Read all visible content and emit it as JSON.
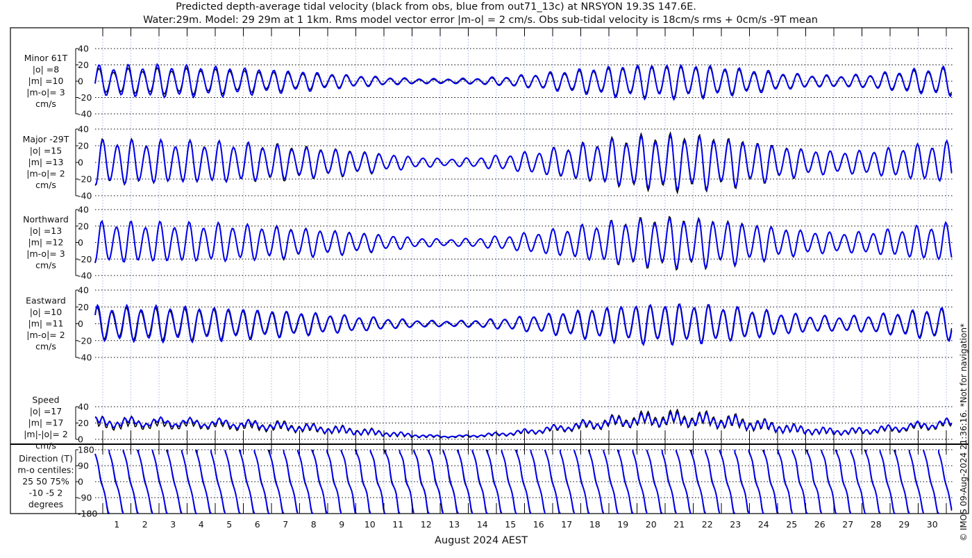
{
  "title": {
    "line1": "Predicted depth-average tidal velocity (black from obs, blue from out71_13c) at NRSYON 19.3S 147.6E.",
    "line2": "Water:29m. Model: 29 29m at 1 1km. Rms model vector error |m-o| = 2 cm/s. Obs sub-tidal velocity is 18cm/s rms + 0cm/s -9T mean"
  },
  "side_note": "© IMOS 09-Aug-2024 21:36:16. *Not for navigation*",
  "colors": {
    "obs": "#000000",
    "model": "#0000ee",
    "grid": "#a8b8e8"
  },
  "chart_data": {
    "type": "line",
    "xlabel": "August 2024 AEST",
    "x_tick_labels": [
      "1",
      "2",
      "3",
      "4",
      "5",
      "6",
      "7",
      "8",
      "9",
      "10",
      "11",
      "12",
      "13",
      "14",
      "15",
      "16",
      "17",
      "18",
      "19",
      "20",
      "21",
      "22",
      "23",
      "24",
      "25",
      "26",
      "27",
      "28",
      "29",
      "30"
    ],
    "x_range": [
      "2024-07-31 18:00",
      "2024-08-31 05:00"
    ],
    "grid": true,
    "amplitude_days": [
      "1",
      "2",
      "3",
      "4",
      "5",
      "6",
      "7",
      "8",
      "9",
      "10",
      "11",
      "12",
      "13",
      "14",
      "15",
      "16",
      "17",
      "18",
      "19",
      "20",
      "21",
      "22",
      "23",
      "24",
      "25",
      "26",
      "27",
      "28",
      "29",
      "30",
      "31"
    ],
    "panels": [
      {
        "id": "minor",
        "label_lines": [
          "Minor 61T",
          "|o| =8",
          "|m| =10",
          "|m-o|= 3",
          "cm/s"
        ],
        "ylim": [
          -40,
          40
        ],
        "yticks": [
          "40",
          "20",
          "0",
          "-20",
          "-40"
        ],
        "obs_daily_amplitude": [
          14,
          15,
          15,
          15,
          14,
          12,
          11,
          9,
          7,
          5,
          3,
          2,
          2,
          3,
          5,
          8,
          11,
          14,
          17,
          18,
          18,
          17,
          14,
          11,
          8,
          6,
          6,
          8,
          11,
          14,
          16
        ],
        "model_daily_amplitude": [
          18,
          19,
          19,
          18,
          17,
          15,
          13,
          11,
          8,
          6,
          4,
          3,
          3,
          4,
          6,
          9,
          13,
          16,
          19,
          20,
          20,
          19,
          16,
          13,
          9,
          7,
          7,
          9,
          13,
          16,
          18
        ]
      },
      {
        "id": "major",
        "label_lines": [
          "Major -29T",
          "|o| =15",
          "|m| =13",
          "|m-o|= 2",
          "cm/s"
        ],
        "ylim": [
          -40,
          40
        ],
        "yticks": [
          "40",
          "20",
          "0",
          "-20",
          "-40"
        ],
        "obs_daily_amplitude": [
          25,
          24,
          23,
          23,
          22,
          21,
          20,
          17,
          15,
          12,
          8,
          5,
          4,
          6,
          9,
          13,
          18,
          23,
          28,
          31,
          32,
          30,
          27,
          22,
          17,
          13,
          12,
          14,
          17,
          21,
          23
        ],
        "model_daily_amplitude": [
          24,
          23,
          23,
          22,
          22,
          20,
          18,
          16,
          14,
          11,
          8,
          5,
          4,
          6,
          9,
          13,
          17,
          22,
          26,
          28,
          29,
          28,
          25,
          21,
          16,
          13,
          12,
          14,
          17,
          21,
          23
        ]
      },
      {
        "id": "northward",
        "label_lines": [
          "Northward",
          "|o| =13",
          "|m| =12",
          "|m-o|= 3",
          "cm/s"
        ],
        "ylim": [
          -40,
          40
        ],
        "yticks": [
          "40",
          "20",
          "0",
          "-20",
          "-40"
        ]
      },
      {
        "id": "eastward",
        "label_lines": [
          "Eastward",
          "|o| =10",
          "|m| =11",
          "|m-o|= 2",
          "cm/s"
        ],
        "ylim": [
          -40,
          40
        ],
        "yticks": [
          "40",
          "20",
          "0",
          "-20",
          "-40"
        ]
      },
      {
        "id": "speed",
        "label_lines": [
          "Speed",
          "|o| =17",
          "|m| =17",
          "|m|-|o|= 2",
          "cm/s"
        ],
        "ylim": [
          0,
          40
        ],
        "yticks": [
          "40",
          "20",
          "0"
        ]
      },
      {
        "id": "direction",
        "label_lines": [
          "Direction (T)",
          "m-o centiles:",
          "25  50  75%",
          "-10  -5   2",
          "degrees"
        ],
        "ylim": [
          -180,
          180
        ],
        "yticks": [
          "180",
          "90",
          "0",
          "-90",
          "-180"
        ]
      }
    ]
  }
}
